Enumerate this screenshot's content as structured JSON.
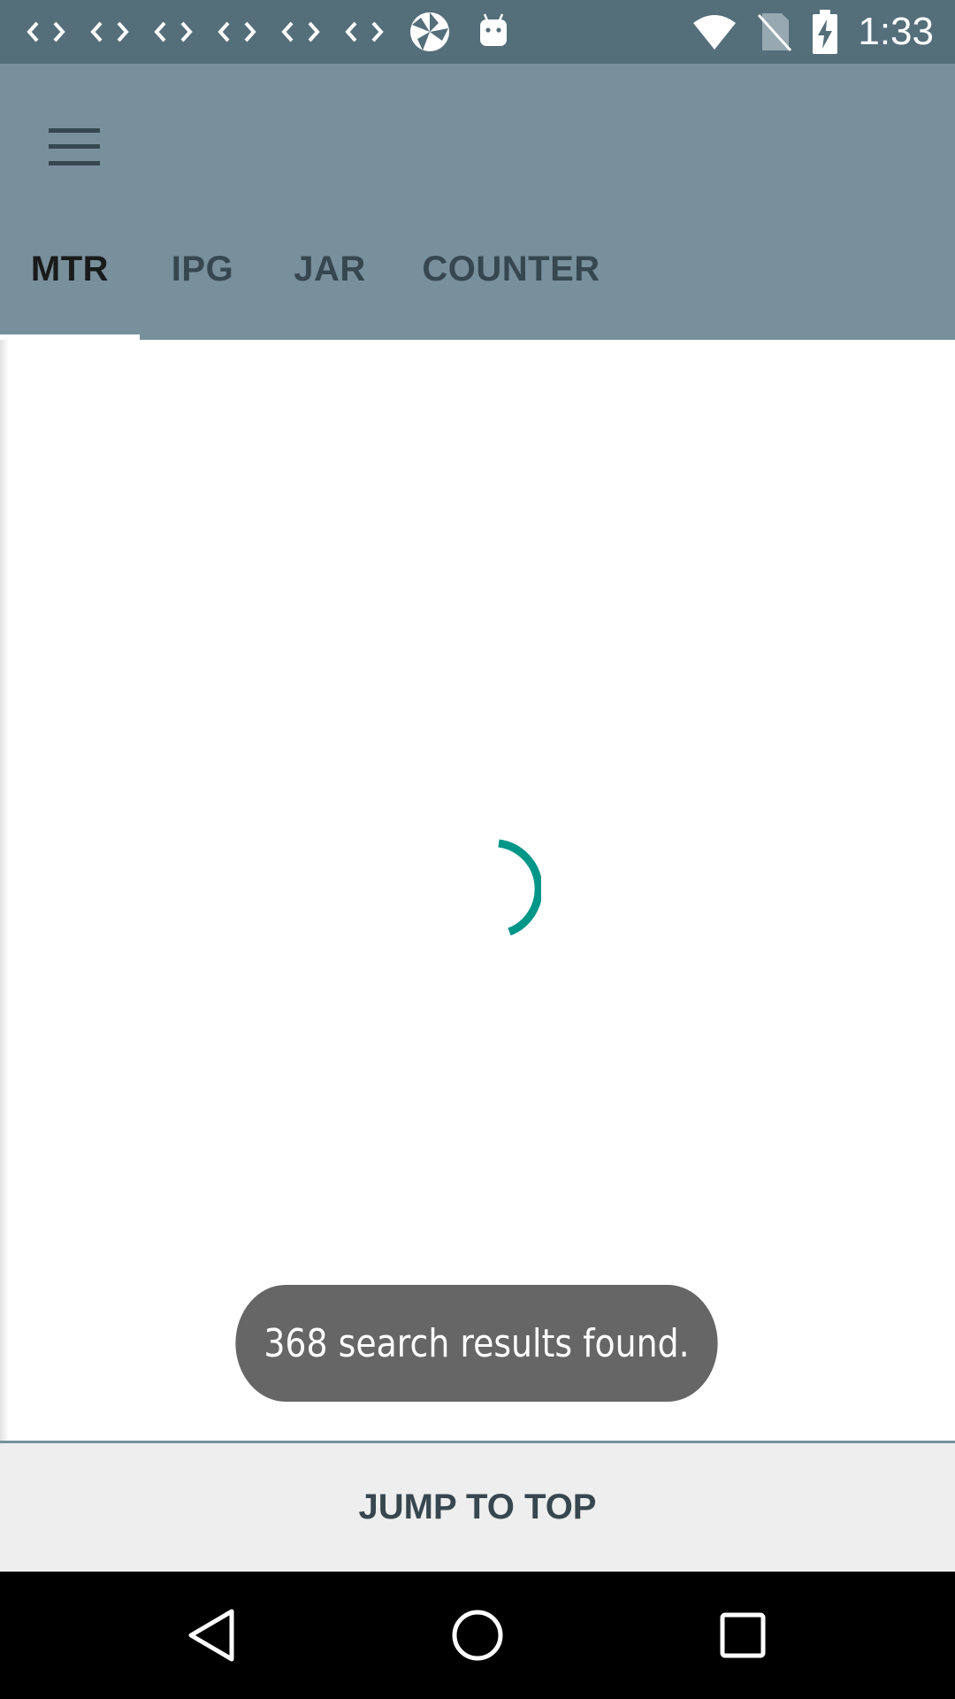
{
  "status_bar": {
    "time": "1:33",
    "notification_icons": [
      "code-icon",
      "code-icon",
      "code-icon",
      "code-icon",
      "code-icon",
      "code-icon",
      "pinwheel-icon",
      "android-icon"
    ],
    "system_icons": [
      "wifi-icon",
      "no-sim-icon",
      "battery-charging-icon"
    ]
  },
  "app_bar": {
    "menu_icon": "hamburger-menu-icon",
    "tabs": [
      {
        "label": "MTR",
        "active": true
      },
      {
        "label": "IPG",
        "active": false
      },
      {
        "label": "JAR",
        "active": false
      },
      {
        "label": "COUNTER",
        "active": false
      }
    ]
  },
  "content": {
    "loading": true,
    "spinner_color": "#009688"
  },
  "toast": {
    "message": "368 search results found."
  },
  "footer": {
    "jump_label": "JUMP TO TOP"
  },
  "nav_bar": {
    "buttons": [
      "back-icon",
      "home-icon",
      "recents-icon"
    ]
  },
  "colors": {
    "status_bar": "#546e7a",
    "app_bar": "#78909c",
    "tab_text": "#37474f",
    "accent": "#009688"
  }
}
